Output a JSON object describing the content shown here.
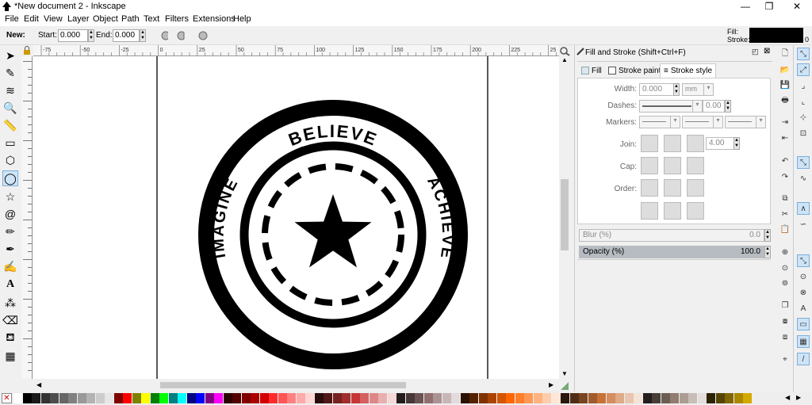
{
  "window": {
    "title": "*New document 2 - Inkscape",
    "minimize": "—",
    "maximize": "❐",
    "close": "✕"
  },
  "menu": [
    "File",
    "Edit",
    "View",
    "Layer",
    "Object",
    "Path",
    "Text",
    "Filters",
    "Extensions",
    "Help"
  ],
  "controls": {
    "new_label": "New:",
    "start_label": "Start:",
    "start_value": "0.000",
    "end_label": "End:",
    "end_value": "0.000"
  },
  "indicator": {
    "fill_label": "Fill:",
    "stroke_label": "Stroke:",
    "stroke_width": "0"
  },
  "ruler": {
    "h_ticks": [
      "-75",
      "-50",
      "-25",
      "0",
      "25",
      "50",
      "75",
      "100",
      "125",
      "150",
      "175",
      "200",
      "225",
      "25"
    ]
  },
  "artwork": {
    "top_text": "BELIEVE",
    "left_text": "IMAGINE",
    "right_text": "ACHIEVE"
  },
  "panel": {
    "title": "Fill and Stroke (Shift+Ctrl+F)",
    "tabs": {
      "fill": "Fill",
      "stroke_paint": "Stroke paint",
      "stroke_style": "Stroke style"
    },
    "width_label": "Width:",
    "width_value": "0.000",
    "unit": "mm",
    "dashes_label": "Dashes:",
    "dash_offset": "0.00",
    "markers_label": "Markers:",
    "join_label": "Join:",
    "miter_value": "4.00",
    "cap_label": "Cap:",
    "order_label": "Order:",
    "blur_label": "Blur (%)",
    "blur_value": "0.0",
    "opacity_label": "Opacity (%)",
    "opacity_value": "100.0"
  },
  "colors": {
    "accent": "#7aaedc",
    "selection": "#cde4f7"
  },
  "palette": [
    "#ffffff",
    "#000000",
    "#1a1a1a",
    "#333333",
    "#4d4d4d",
    "#666666",
    "#808080",
    "#999999",
    "#b3b3b3",
    "#cccccc",
    "#e6e6e6",
    "#800000",
    "#ff0000",
    "#808000",
    "#ffff00",
    "#008000",
    "#00ff00",
    "#008080",
    "#00ffff",
    "#000080",
    "#0000ff",
    "#800080",
    "#ff00ff",
    "#2b0000",
    "#550000",
    "#800000",
    "#aa0000",
    "#d40000",
    "#ff2a2a",
    "#ff5555",
    "#ff8080",
    "#ffaaaa",
    "#ffd5d5",
    "#280b0b",
    "#501616",
    "#782121",
    "#a02c2c",
    "#c83737",
    "#d35f5f",
    "#de8787",
    "#e9afaf",
    "#f4d7d7",
    "#241c1c",
    "#483737",
    "#6c5353",
    "#916f6f",
    "#ac9393",
    "#c8b7b7",
    "#e3dbdb",
    "#2b1100",
    "#552200",
    "#803300",
    "#aa4400",
    "#d45500",
    "#ff6600",
    "#ff7f2a",
    "#ff9955",
    "#ffb380",
    "#ffccaa",
    "#ffe6d5",
    "#28170b",
    "#502d16",
    "#784421",
    "#a05a2c",
    "#c87137",
    "#d38d5f",
    "#deaa87",
    "#e9c6af",
    "#f4e3d7",
    "#241f1c",
    "#483e37",
    "#6c5d53",
    "#917c6f",
    "#ac9d93",
    "#c8beb7",
    "#e3dedb",
    "#2b2200",
    "#554400",
    "#806600",
    "#aa8800",
    "#d4aa00"
  ]
}
